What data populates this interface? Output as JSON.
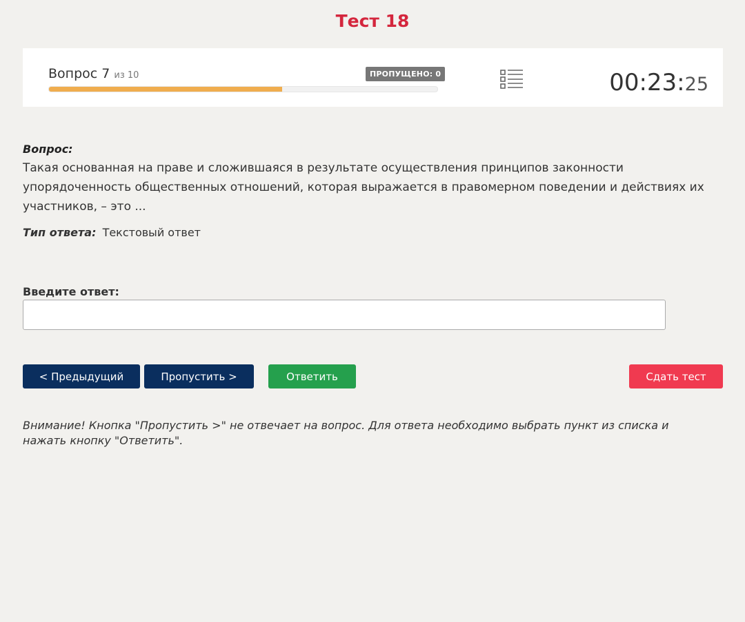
{
  "page": {
    "title": "Тест 18"
  },
  "header": {
    "question_label": "Вопрос 7",
    "question_of": "из 10",
    "skipped_badge": "ПРОПУЩЕНО: 0",
    "progress_percent": 60,
    "list_icon": "list-icon",
    "timer_main": "00:23:",
    "timer_seconds": "25"
  },
  "question": {
    "label": "Вопрос:",
    "text": "Такая основанная на праве и сложившаяся в результате осуществления принципов законности упорядоченность общественных отношений, которая выражается в правомерном поведении и действиях их участников, – это ..."
  },
  "answer_type": {
    "label": "Тип ответа:",
    "value": "Текстовый ответ"
  },
  "answer": {
    "label": "Введите ответ:",
    "value": "",
    "placeholder": ""
  },
  "buttons": {
    "prev": "< Предыдущий",
    "skip": "Пропустить >",
    "answer": "Ответить",
    "submit": "Сдать тест"
  },
  "colors": {
    "title": "#d4263d",
    "progress": "#f0ad4e",
    "navy": "#0a2e5e",
    "green": "#25a04d",
    "red": "#f03a50"
  },
  "note": "Внимание! Кнопка \"Пропустить >\" не отвечает на вопрос. Для ответа необходимо выбрать пункт из списка и нажать кнопку \"Ответить\"."
}
